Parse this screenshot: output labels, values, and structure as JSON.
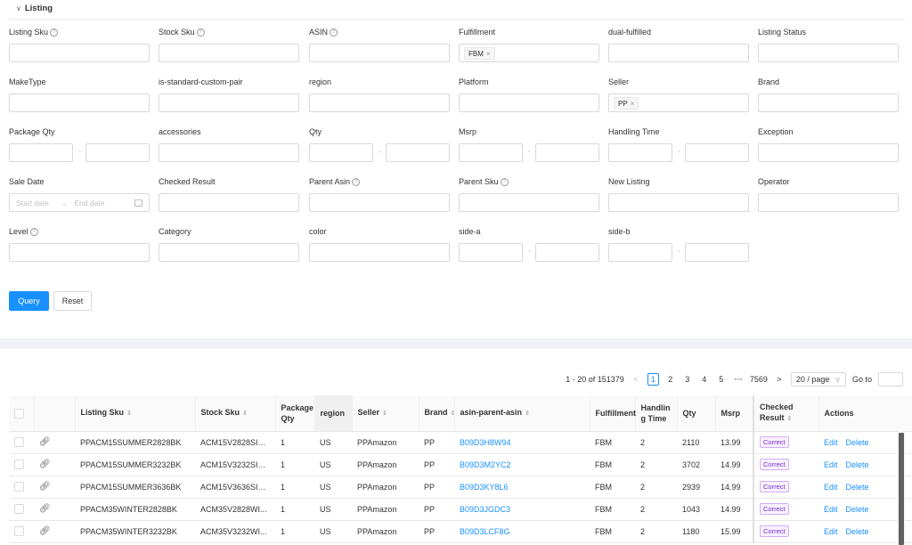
{
  "panel": {
    "title": "Listing"
  },
  "filters": [
    {
      "key": "listing_sku",
      "label": "Listing Sku",
      "help": true
    },
    {
      "key": "stock_sku",
      "label": "Stock Sku",
      "help": true
    },
    {
      "key": "asin",
      "label": "ASIN",
      "help": true
    },
    {
      "key": "fulfillment",
      "label": "Fulfillment",
      "tag": "FBM"
    },
    {
      "key": "dual_fulfilled",
      "label": "dual-fulfilled"
    },
    {
      "key": "listing_status",
      "label": "Listing Status"
    },
    {
      "key": "make_type",
      "label": "MakeType"
    },
    {
      "key": "is_standard_custom_pair",
      "label": "is-standard-custom-pair"
    },
    {
      "key": "region",
      "label": "region"
    },
    {
      "key": "platform",
      "label": "Platform"
    },
    {
      "key": "seller",
      "label": "Seller",
      "tag": "PP"
    },
    {
      "key": "brand",
      "label": "Brand"
    },
    {
      "key": "package_qty",
      "label": "Package Qty",
      "range": true
    },
    {
      "key": "accessories",
      "label": "accessories"
    },
    {
      "key": "qty",
      "label": "Qty",
      "range": true
    },
    {
      "key": "msrp",
      "label": "Msrp",
      "range": true
    },
    {
      "key": "handling_time",
      "label": "Handling Time",
      "range": true
    },
    {
      "key": "exception",
      "label": "Exception"
    },
    {
      "key": "sale_date",
      "label": "Sale Date",
      "date": true
    },
    {
      "key": "checked_result",
      "label": "Checked Result"
    },
    {
      "key": "parent_asin",
      "label": "Parent Asin",
      "help": true
    },
    {
      "key": "parent_sku",
      "label": "Parent Sku",
      "help": true
    },
    {
      "key": "new_listing",
      "label": "New Listing"
    },
    {
      "key": "operator",
      "label": "Operator"
    },
    {
      "key": "level",
      "label": "Level",
      "help": true
    },
    {
      "key": "category",
      "label": "Category"
    },
    {
      "key": "color",
      "label": "color"
    },
    {
      "key": "side_a",
      "label": "side-a",
      "range": true
    },
    {
      "key": "side_b",
      "label": "side-b",
      "range": true
    }
  ],
  "date_placeholder": {
    "start": "Start date",
    "end": "End date"
  },
  "buttons": {
    "query": "Query",
    "reset": "Reset"
  },
  "pagination": {
    "range": "1 - 20 of 151379",
    "pages": [
      "1",
      "2",
      "3",
      "4",
      "5"
    ],
    "ellipsis": "•••",
    "last": "7569",
    "page_size": "20 / page",
    "goto": "Go to"
  },
  "table": {
    "columns": [
      "Listing Sku",
      "Stock Sku",
      "Package Qty",
      "region",
      "Seller",
      "Brand",
      "asin-parent-asin",
      "Fulfillment",
      "Handling Time",
      "Qty",
      "Msrp",
      "Checked Result",
      "Actions"
    ],
    "column_display": [
      "Listing Sku",
      "Stock Sku",
      "Package\nQty",
      "region",
      "Seller",
      "Brand",
      "asin-parent-asin",
      "Fulfillment",
      "Handlin\ng Time",
      "Qty",
      "Msrp",
      "Checked\nResult",
      "Actions"
    ],
    "actions": {
      "edit": "Edit",
      "delete": "Delete"
    },
    "rows": [
      {
        "listing_sku": "PPACM15SUMMER2828BK",
        "stock_sku": "ACM15V2828SIN...",
        "package_qty": "1",
        "region": "US",
        "seller": "PPAmazon",
        "brand": "PP",
        "asin": "B09D3H8W94",
        "fulfillment": "FBM",
        "handling_time": "2",
        "qty": "2110",
        "msrp": "13.99",
        "checked": "Correct"
      },
      {
        "listing_sku": "PPACM15SUMMER3232BK",
        "stock_sku": "ACM15V3232SIN...",
        "package_qty": "1",
        "region": "US",
        "seller": "PPAmazon",
        "brand": "PP",
        "asin": "B09D3M2YC2",
        "fulfillment": "FBM",
        "handling_time": "2",
        "qty": "3702",
        "msrp": "14.99",
        "checked": "Correct"
      },
      {
        "listing_sku": "PPACM15SUMMER3636BK",
        "stock_sku": "ACM15V3636SIN...",
        "package_qty": "1",
        "region": "US",
        "seller": "PPAmazon",
        "brand": "PP",
        "asin": "B09D3KY8L6",
        "fulfillment": "FBM",
        "handling_time": "2",
        "qty": "2939",
        "msrp": "14.99",
        "checked": "Correct"
      },
      {
        "listing_sku": "PPACM35WINTER2828BK",
        "stock_sku": "ACM35V2828WI...",
        "package_qty": "1",
        "region": "US",
        "seller": "PPAmazon",
        "brand": "PP",
        "asin": "B09D3JGDC3",
        "fulfillment": "FBM",
        "handling_time": "2",
        "qty": "1043",
        "msrp": "14.99",
        "checked": "Correct"
      },
      {
        "listing_sku": "PPACM35WINTER3232BK",
        "stock_sku": "ACM35V3232WI...",
        "package_qty": "1",
        "region": "US",
        "seller": "PPAmazon",
        "brand": "PP",
        "asin": "B09D3LCF8G",
        "fulfillment": "FBM",
        "handling_time": "2",
        "qty": "1180",
        "msrp": "15.99",
        "checked": "Correct"
      }
    ]
  }
}
